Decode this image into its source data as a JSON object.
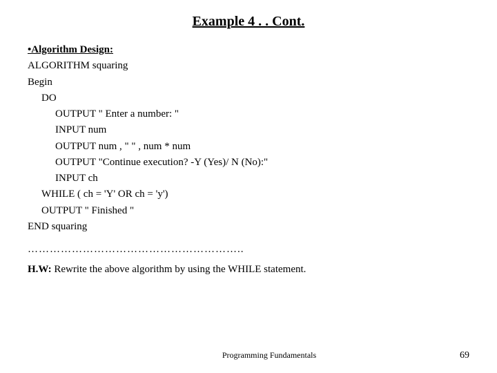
{
  "title": "Example 4 . .  Cont.",
  "algorithm_header": "•Algorithm Design:",
  "line1": "ALGORITHM squaring",
  "line2": "Begin",
  "line3": "DO",
  "line4": "OUTPUT  \" Enter a number: \"",
  "line5": "INPUT  num",
  "line6": "OUTPUT     num ,  \"      \" ,  num * num",
  "line7": "OUTPUT  \"Continue execution? -Y (Yes)/ N (No):\"",
  "line8": "INPUT  ch",
  "line9": "WHILE ( ch = 'Y'  OR   ch = 'y')",
  "line10": "OUTPUT  \" Finished \"",
  "line11": "END squaring",
  "divider": "…………………………………………………..",
  "hw_line": "H.W: Rewrite the above algorithm by using the WHILE statement.",
  "footer_label": "Programming Fundamentals",
  "footer_page": "69"
}
